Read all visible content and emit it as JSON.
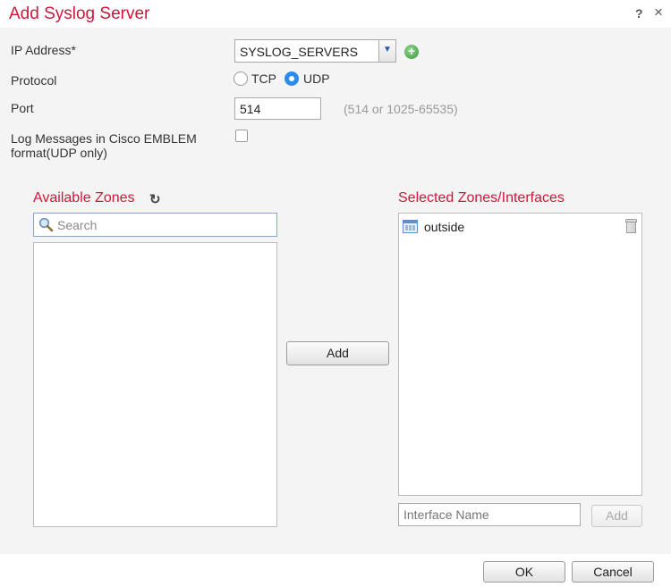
{
  "dialog": {
    "title": "Add Syslog Server",
    "help_icon": "?",
    "close_icon": "×"
  },
  "form": {
    "ip_label": "IP Address*",
    "ip_value": "SYSLOG_SERVERS",
    "protocol_label": "Protocol",
    "protocol_options": [
      "TCP",
      "UDP"
    ],
    "protocol_selected": "UDP",
    "port_label": "Port",
    "port_value": "514",
    "port_hint": "(514 or 1025-65535)",
    "emblem_label_line1": "Log Messages in Cisco EMBLEM",
    "emblem_label_line2": "format(UDP only)",
    "emblem_checked": false
  },
  "zones": {
    "available_title": "Available Zones",
    "search_placeholder": "Search",
    "selected_title": "Selected Zones/Interfaces",
    "selected_items": [
      "outside"
    ],
    "add_button": "Add",
    "interface_placeholder": "Interface Name",
    "interface_add_button": "Add"
  },
  "footer": {
    "ok": "OK",
    "cancel": "Cancel"
  },
  "colors": {
    "accent": "#d2153a",
    "radio_selected": "#2d8ceb"
  },
  "icons": [
    "help-icon",
    "close-icon",
    "chevron-down-icon",
    "add-icon",
    "refresh-icon",
    "search-icon",
    "interface-icon",
    "trash-icon"
  ]
}
